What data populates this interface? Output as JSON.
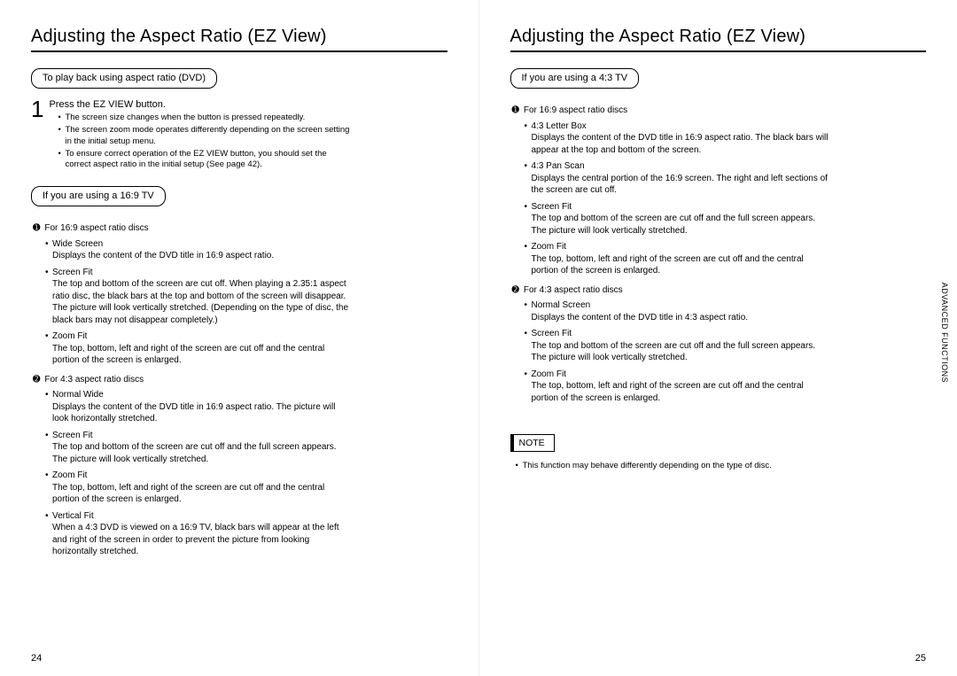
{
  "left": {
    "title": "Adjusting the Aspect Ratio (EZ View)",
    "pill_playback": "To play back using aspect ratio (DVD)",
    "step_number": "1",
    "step_heading": "Press the EZ VIEW button.",
    "step_bullets": [
      "The screen size changes when the button is pressed repeatedly.",
      "The screen zoom mode operates differently depending on the screen setting in the initial setup menu.",
      "To ensure correct operation of the EZ VIEW button, you should set the correct aspect ratio in the initial setup (See page 42)."
    ],
    "pill_169": "If you are using a 16:9 TV",
    "g1": {
      "icon": "➊",
      "label": "For 16:9 aspect ratio discs",
      "items": [
        {
          "t": "Wide Screen",
          "b": "Displays the content of the DVD title in 16:9 aspect ratio."
        },
        {
          "t": "Screen Fit",
          "b": "The top and bottom of the screen are cut off. When playing a 2.35:1 aspect ratio disc, the black bars at the top and bottom of the screen will disappear. The picture will look vertically stretched. (Depending on the type of disc, the black bars may not disappear completely.)"
        },
        {
          "t": "Zoom Fit",
          "b": "The top, bottom, left and right of the screen are cut off and the central portion of the screen is enlarged."
        }
      ]
    },
    "g2": {
      "icon": "➋",
      "label": "For 4:3 aspect ratio discs",
      "items": [
        {
          "t": "Normal Wide",
          "b": "Displays the content of the DVD title in 16:9 aspect ratio. The picture will look horizontally stretched."
        },
        {
          "t": "Screen Fit",
          "b": "The top and bottom of the screen are cut off and the full screen appears. The picture will look vertically stretched."
        },
        {
          "t": "Zoom Fit",
          "b": "The top, bottom, left and right of the screen are cut off and the central portion of the screen is enlarged."
        },
        {
          "t": "Vertical Fit",
          "b": "When a 4:3 DVD is viewed on a 16:9 TV, black bars will appear at the left and right of the screen in order to prevent the picture from looking horizontally stretched."
        }
      ]
    },
    "page_num": "24"
  },
  "right": {
    "title": "Adjusting the Aspect Ratio (EZ View)",
    "pill_43": "If you are using a 4:3 TV",
    "g1": {
      "icon": "➊",
      "label": "For 16:9 aspect ratio discs",
      "items": [
        {
          "t": "4:3 Letter Box",
          "b": "Displays the content of the DVD title in 16:9 aspect ratio. The black bars will appear at the top and bottom of the screen."
        },
        {
          "t": "4:3 Pan Scan",
          "b": "Displays the central portion of the 16:9 screen. The right and left sections of the screen are cut off."
        },
        {
          "t": "Screen Fit",
          "b": "The top and bottom of the screen are cut off and the full screen appears. The picture will look vertically stretched."
        },
        {
          "t": "Zoom Fit",
          "b": "The top, bottom, left and right of the screen are cut off and the central portion of the screen is enlarged."
        }
      ]
    },
    "g2": {
      "icon": "➋",
      "label": "For 4:3 aspect ratio discs",
      "items": [
        {
          "t": "Normal Screen",
          "b": "Displays the content of the DVD title in 4:3 aspect ratio."
        },
        {
          "t": "Screen Fit",
          "b": "The top and bottom of the screen are cut off and the full screen appears. The picture will look vertically stretched."
        },
        {
          "t": "Zoom Fit",
          "b": "The top, bottom, left and right of the screen are cut off and the central portion of the screen is enlarged."
        }
      ]
    },
    "note_label": "NOTE",
    "note_items": [
      "This function may behave differently depending on the type of disc."
    ],
    "side_tab": "ADVANCED\nFUNCTIONS",
    "page_num": "25"
  }
}
